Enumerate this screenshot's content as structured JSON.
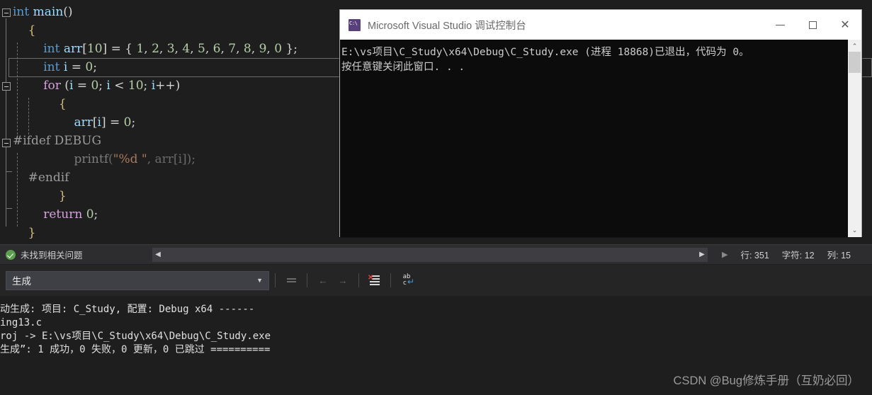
{
  "editor": {
    "lines": [
      {
        "indent": 0,
        "fold": true,
        "tokens": [
          {
            "t": "int",
            "c": "key"
          },
          {
            "t": " ",
            "c": "punct"
          },
          {
            "t": "main",
            "c": "var"
          },
          {
            "t": "()",
            "c": "punct"
          }
        ]
      },
      {
        "indent": 1,
        "fold": false,
        "tokens": [
          {
            "t": "{",
            "c": "brace"
          }
        ]
      },
      {
        "indent": 2,
        "fold": false,
        "tokens": [
          {
            "t": "int",
            "c": "key"
          },
          {
            "t": " ",
            "c": "punct"
          },
          {
            "t": "arr",
            "c": "var"
          },
          {
            "t": "[",
            "c": "punct"
          },
          {
            "t": "10",
            "c": "num"
          },
          {
            "t": "] = { ",
            "c": "punct"
          },
          {
            "t": "1",
            "c": "num"
          },
          {
            "t": ", ",
            "c": "punct"
          },
          {
            "t": "2",
            "c": "num"
          },
          {
            "t": ", ",
            "c": "punct"
          },
          {
            "t": "3",
            "c": "num"
          },
          {
            "t": ", ",
            "c": "punct"
          },
          {
            "t": "4",
            "c": "num"
          },
          {
            "t": ", ",
            "c": "punct"
          },
          {
            "t": "5",
            "c": "num"
          },
          {
            "t": ", ",
            "c": "punct"
          },
          {
            "t": "6",
            "c": "num"
          },
          {
            "t": ", ",
            "c": "punct"
          },
          {
            "t": "7",
            "c": "num"
          },
          {
            "t": ", ",
            "c": "punct"
          },
          {
            "t": "8",
            "c": "num"
          },
          {
            "t": ", ",
            "c": "punct"
          },
          {
            "t": "9",
            "c": "num"
          },
          {
            "t": ", ",
            "c": "punct"
          },
          {
            "t": "0",
            "c": "num"
          },
          {
            "t": " };",
            "c": "punct"
          }
        ]
      },
      {
        "indent": 2,
        "fold": false,
        "current": true,
        "tokens": [
          {
            "t": "int",
            "c": "key"
          },
          {
            "t": " ",
            "c": "punct"
          },
          {
            "t": "i",
            "c": "var"
          },
          {
            "t": " = ",
            "c": "punct"
          },
          {
            "t": "0",
            "c": "num"
          },
          {
            "t": ";",
            "c": "punct"
          }
        ]
      },
      {
        "indent": 2,
        "fold": true,
        "tokens": [
          {
            "t": "for",
            "c": "kw2"
          },
          {
            "t": " (",
            "c": "punct"
          },
          {
            "t": "i",
            "c": "var"
          },
          {
            "t": " = ",
            "c": "punct"
          },
          {
            "t": "0",
            "c": "num"
          },
          {
            "t": "; ",
            "c": "punct"
          },
          {
            "t": "i",
            "c": "var"
          },
          {
            "t": " < ",
            "c": "punct"
          },
          {
            "t": "10",
            "c": "num"
          },
          {
            "t": "; ",
            "c": "punct"
          },
          {
            "t": "i",
            "c": "var"
          },
          {
            "t": "++)",
            "c": "punct"
          }
        ]
      },
      {
        "indent": 3,
        "fold": false,
        "tokens": [
          {
            "t": "{",
            "c": "brace"
          }
        ]
      },
      {
        "indent": 4,
        "fold": false,
        "tokens": [
          {
            "t": "arr",
            "c": "var"
          },
          {
            "t": "[",
            "c": "punct"
          },
          {
            "t": "i",
            "c": "var"
          },
          {
            "t": "] = ",
            "c": "punct"
          },
          {
            "t": "0",
            "c": "num"
          },
          {
            "t": ";",
            "c": "punct"
          }
        ]
      },
      {
        "indent": 0,
        "fold": true,
        "tokens": [
          {
            "t": "#ifdef",
            "c": "pp"
          },
          {
            "t": " ",
            "c": "punct"
          },
          {
            "t": "DEBUG",
            "c": "pp"
          }
        ]
      },
      {
        "indent": 4,
        "fold": false,
        "tokens": [
          {
            "t": "printf",
            "c": "fn"
          },
          {
            "t": "(",
            "c": "dim"
          },
          {
            "t": "\"%d \"",
            "c": "str"
          },
          {
            "t": ", ",
            "c": "dim"
          },
          {
            "t": "arr",
            "c": "dim"
          },
          {
            "t": "[",
            "c": "dim"
          },
          {
            "t": "i",
            "c": "dim"
          },
          {
            "t": "]);",
            "c": "dim"
          }
        ]
      },
      {
        "indent": 1,
        "fold": false,
        "tokens": [
          {
            "t": "#endif",
            "c": "pp"
          }
        ]
      },
      {
        "indent": 3,
        "fold": false,
        "tokens": [
          {
            "t": "}",
            "c": "brace"
          }
        ]
      },
      {
        "indent": 2,
        "fold": false,
        "tokens": [
          {
            "t": "return",
            "c": "kw2"
          },
          {
            "t": " ",
            "c": "punct"
          },
          {
            "t": "0",
            "c": "num"
          },
          {
            "t": ";",
            "c": "punct"
          }
        ]
      },
      {
        "indent": 1,
        "fold": false,
        "tokens": [
          {
            "t": "}",
            "c": "brace"
          }
        ]
      }
    ]
  },
  "status_bar": {
    "issue_status": "未找到相关问题",
    "line_label": "行: 351",
    "char_label": "字符: 12",
    "col_label": "列: 15",
    "scroll_left_arrow": "◀",
    "scroll_right_arrow": "▶",
    "caret_arrow": "▶"
  },
  "console_window": {
    "title": "Microsoft Visual Studio 调试控制台",
    "icon": "cmd-prompt-icon",
    "minimize_label": "—",
    "maximize_label": "□",
    "close_label": "✕",
    "output_line_1": "E:\\vs项目\\C_Study\\x64\\Debug\\C_Study.exe (进程 18868)已退出，代码为 0。",
    "output_line_2": "按任意键关闭此窗口. . .",
    "scroll_up_arrow": "⌃",
    "scroll_down_arrow": "⌄"
  },
  "output_panel": {
    "source_selector_value": "生成",
    "source_selector_arrow": "▼",
    "toolbar_buttons": [
      {
        "name": "goto-source",
        "label": "转到源位置",
        "enabled": false
      },
      {
        "name": "prev-message",
        "label": "上一条消息",
        "enabled": false
      },
      {
        "name": "next-message",
        "label": "下一条消息",
        "enabled": false
      },
      {
        "name": "clear-all",
        "label": "全部清除",
        "enabled": true
      },
      {
        "name": "toggle-word-wrap",
        "label": "自动换行",
        "enabled": true
      }
    ],
    "lines": [
      "动生成: 项目: C_Study, 配置: Debug x64 ------",
      "ing13.c",
      "roj -> E:\\vs项目\\C_Study\\x64\\Debug\\C_Study.exe",
      "生成”: 1 成功，0 失败，0 更新，0 已跳过 =========="
    ]
  },
  "watermark": {
    "text": "CSDN @Bug修炼手册（互奶必回）"
  },
  "colors": {
    "editor_bg": "#1e1e1e",
    "panel_bg": "#252526",
    "status_bg": "#2d2d30",
    "console_bg": "#0c0c0c",
    "keyword": "#569cd6",
    "keyword2": "#d8a0df",
    "number": "#b5cea8",
    "identifier": "#9cdcfe",
    "success": "#5e9e4f",
    "clear_icon": "#e04343"
  }
}
